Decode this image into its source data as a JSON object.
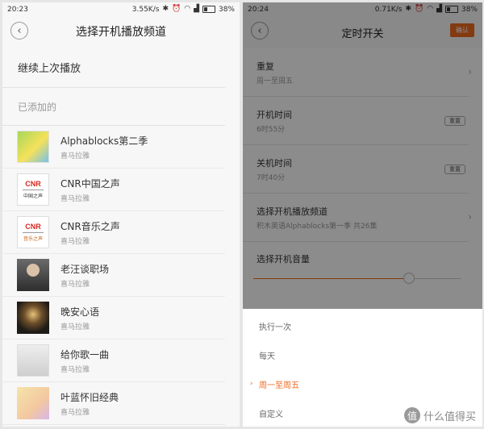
{
  "left": {
    "status": {
      "time": "20:23",
      "speed": "3.55K/s",
      "battery": "38%"
    },
    "title": "选择开机播放频道",
    "continue_label": "继续上次播放",
    "section_label": "已添加的",
    "channels": [
      {
        "title": "Alphablocks第二季",
        "subtitle": "喜马拉雅"
      },
      {
        "title": "CNR中国之声",
        "subtitle": "喜马拉雅",
        "logo": "CNR",
        "logo_caption": "中国之声"
      },
      {
        "title": "CNR音乐之声",
        "subtitle": "喜马拉雅",
        "logo": "CNR",
        "logo_caption": "音乐之声"
      },
      {
        "title": "老汪谈职场",
        "subtitle": "喜马拉雅"
      },
      {
        "title": "晚安心语",
        "subtitle": "喜马拉雅"
      },
      {
        "title": "给你歌一曲",
        "subtitle": "喜马拉雅"
      },
      {
        "title": "叶蓝怀旧经典",
        "subtitle": "喜马拉雅"
      }
    ]
  },
  "right": {
    "status": {
      "time": "20:24",
      "speed": "0.71K/s",
      "battery": "38%"
    },
    "title": "定时开关",
    "confirm_label": "确认",
    "repeat": {
      "title": "重复",
      "value": "周一至周五"
    },
    "power_on": {
      "title": "开机时间",
      "value": "6时55分",
      "reset": "重置"
    },
    "power_off": {
      "title": "关机时间",
      "value": "7时40分",
      "reset": "重置"
    },
    "channel": {
      "title": "选择开机播放频道",
      "value": "积木英语Alphablocks第一季 共26集"
    },
    "volume": {
      "title": "选择开机音量",
      "level": 0.75
    },
    "options": [
      "执行一次",
      "每天",
      "周一至周五",
      "自定义"
    ],
    "selected_option": "周一至周五"
  },
  "watermark": {
    "text": "什么值得买",
    "badge": "值"
  },
  "colors": {
    "accent": "#ef6a1f"
  }
}
